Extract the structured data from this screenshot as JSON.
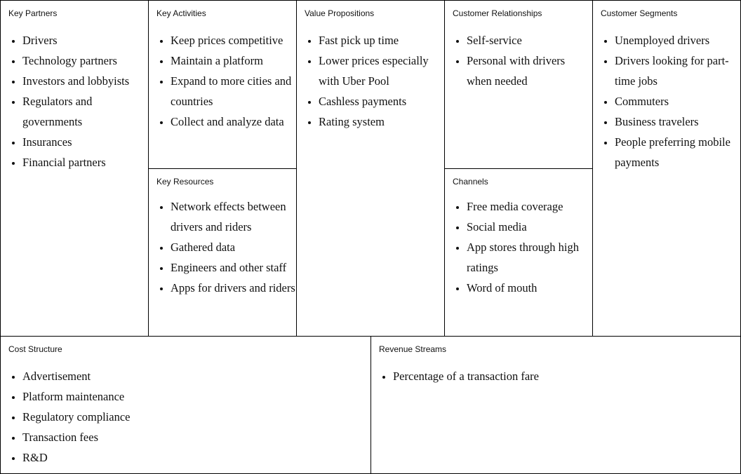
{
  "canvas": {
    "key_partners": {
      "title": "Key Partners",
      "items": [
        "Drivers",
        "Technology partners",
        "Investors and lobbyists",
        "Regulators and governments",
        "Insurances",
        "Financial partners"
      ]
    },
    "key_activities": {
      "title": "Key Activities",
      "items": [
        "Keep prices competitive",
        "Maintain a platform",
        "Expand to more cities and countries",
        "Collect and analyze data"
      ]
    },
    "key_resources": {
      "title": "Key Resources",
      "items": [
        "Network effects between drivers and riders",
        "Gathered data",
        "Engineers and other staff",
        "Apps for drivers and riders"
      ]
    },
    "value_propositions": {
      "title": "Value Propositions",
      "items": [
        "Fast pick up time",
        "Lower prices especially with Uber Pool",
        "Cashless payments",
        "Rating system"
      ]
    },
    "customer_relationships": {
      "title": "Customer Relationships",
      "items": [
        "Self-service",
        "Personal with drivers when needed"
      ]
    },
    "channels": {
      "title": "Channels",
      "items": [
        "Free media coverage",
        "Social media",
        "App stores through high ratings",
        "Word of mouth"
      ]
    },
    "customer_segments": {
      "title": "Customer Segments",
      "items": [
        "Unemployed drivers",
        "Drivers looking for part-time jobs",
        "Commuters",
        "Business travelers",
        "People preferring mobile payments"
      ]
    },
    "cost_structure": {
      "title": "Cost Structure",
      "items": [
        "Advertisement",
        "Platform maintenance",
        "Regulatory compliance",
        "Transaction fees",
        "R&D"
      ]
    },
    "revenue_streams": {
      "title": "Revenue Streams",
      "items": [
        "Percentage of a transaction fare"
      ]
    }
  }
}
